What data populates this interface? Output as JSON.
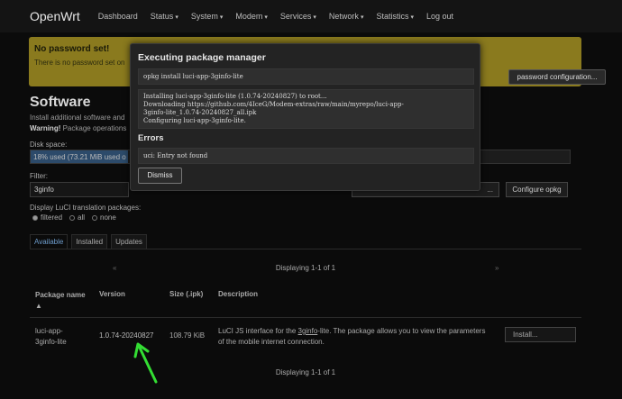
{
  "nav": {
    "brand": "OpenWrt",
    "items": [
      {
        "label": "Dashboard",
        "caret": false
      },
      {
        "label": "Status",
        "caret": true
      },
      {
        "label": "System",
        "caret": true
      },
      {
        "label": "Modem",
        "caret": true
      },
      {
        "label": "Services",
        "caret": true
      },
      {
        "label": "Network",
        "caret": true
      },
      {
        "label": "Statistics",
        "caret": true
      },
      {
        "label": "Log out",
        "caret": false
      }
    ]
  },
  "warning": {
    "title": "No password set!",
    "text": "There is no password set on",
    "button": "password configuration..."
  },
  "software": {
    "title": "Software",
    "desc1": "Install additional software and",
    "desc2_bold": "Warning!",
    "desc2_rest": " Package operations",
    "disk_label": "Disk space:",
    "disk_text": "18% used (73.21 MiB used o",
    "disk_used_fraction": 0.18,
    "filter_label": "Filter:",
    "filter_value": "3ginfo",
    "download_btn": "...",
    "configure_btn": "Configure opkg",
    "trans_label": "Display LuCI translation packages:",
    "radios": [
      {
        "label": "filtered",
        "on": true
      },
      {
        "label": "all",
        "on": false
      },
      {
        "label": "none",
        "on": false
      }
    ]
  },
  "tabs": [
    "Available",
    "Installed",
    "Updates"
  ],
  "pager": {
    "prev": "«",
    "next": "»",
    "text": "Displaying 1-1 of 1"
  },
  "table": {
    "headers": {
      "name": "Package name ▲",
      "version": "Version",
      "size": "Size (.ipk)",
      "description": "Description"
    },
    "row": {
      "name": "luci-app-3ginfo-lite",
      "version": "1.0.74-20240827",
      "size": "108.79 KiB",
      "desc_pre": "LuCI JS interface for the ",
      "desc_link": "3ginfo",
      "desc_post": "-lite. The package allows you to view the parameters of the mobile internet connection.",
      "install": "Install..."
    }
  },
  "modal": {
    "title": "Executing package manager",
    "command": "opkg install luci-app-3ginfo-lite",
    "output": "Installing luci-app-3ginfo-lite (1.0.74-20240827) to root...\nDownloading https://github.com/4IceG/Modem-extras/raw/main/myrepo/luci-app-\n3ginfo-lite_1.0.74-20240827_all.ipk\nConfiguring luci-app-3ginfo-lite.",
    "errors_title": "Errors",
    "error": "uci: Entry not found",
    "dismiss": "Dismiss"
  },
  "colors": {
    "arrow": "#33dd33",
    "warning_bg": "#8a7a1e",
    "tab_active": "#6e9ccc"
  }
}
